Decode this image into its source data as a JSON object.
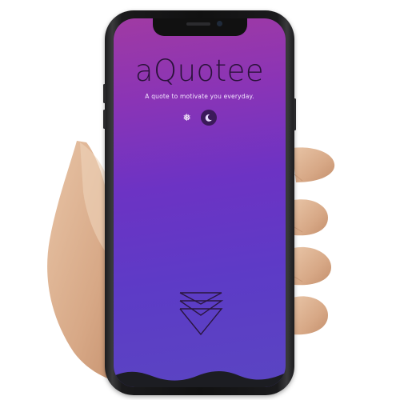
{
  "app": {
    "name": "aQuotee",
    "tagline": "A quote to motivate you everyday."
  },
  "theme_toggle": {
    "light_icon": "sun-icon",
    "dark_icon": "moon-icon",
    "selected": "dark"
  },
  "scroll_indicator": {
    "icon": "triple-chevron-down-icon"
  },
  "colors": {
    "gradient_top": "#a03aa3",
    "gradient_bottom": "#5a45c2",
    "brand_text": "#2a123a",
    "wave": "#1c1d22"
  }
}
